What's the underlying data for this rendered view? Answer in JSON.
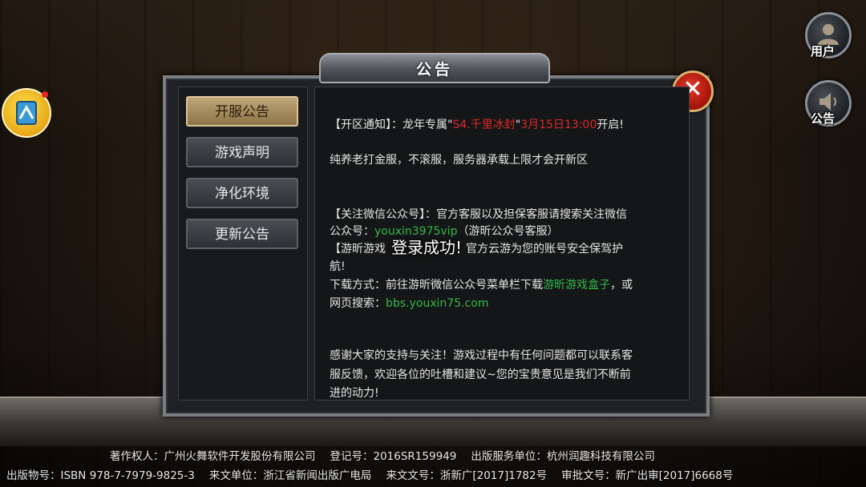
{
  "panel_title": "公告",
  "close_icon": "close-icon",
  "right_buttons": [
    {
      "label": "用户",
      "icon": "user-icon"
    },
    {
      "label": "公告",
      "icon": "speaker-icon"
    }
  ],
  "tabs": [
    {
      "label": "开服公告",
      "active": true
    },
    {
      "label": "游戏声明",
      "active": false
    },
    {
      "label": "净化环境",
      "active": false
    },
    {
      "label": "更新公告",
      "active": false
    }
  ],
  "notice": {
    "l1_prefix": "【开区通知】：龙年专属\"",
    "l1_server": "S4.千里冰封",
    "l1_mid": "\"",
    "l1_time": "3月15日13:00",
    "l1_suffix": "开启!",
    "l2": "纯养老打金服，不滚服，服务器承载上限才会开新区",
    "l3": "【关注微信公众号】：官方客服以及担保客服请搜索关注微信",
    "l4_prefix": "公众号：",
    "l4_account": "youxin3975vip",
    "l4_suffix": "（游昕公众号客服）",
    "l5_prefix": "【游昕游戏",
    "l5_suffix": "官方云游为您的账号安全保驾护",
    "l6": "航!",
    "l7_prefix": "下载方式：前往游昕微信公众号菜单栏下载",
    "l7_link": "游昕游戏盒子",
    "l7_suffix": "，或",
    "l8_prefix": "网页搜索：",
    "l8_link": "bbs.youxin75.com",
    "l9": "感谢大家的支持与关注！游戏过程中有任何问题都可以联系客",
    "l10": "服反馈，欢迎各位的吐槽和建议~您的宝贵意见是我们不断前",
    "l11": "进的动力!"
  },
  "toast": "登录成功!",
  "footer": {
    "copyright": "著作权人：广州火舞软件开发股份有限公司",
    "reg": "登记号：2016SR159949",
    "publisher": "出版服务单位：杭州润趣科技有限公司",
    "isbn": "出版物号：ISBN 978-7-7979-9825-3",
    "from_unit": "来文单位：浙江省新闻出版广电局",
    "doc_no": "来文文号：浙新广[2017]1782号",
    "approval": "审批文号：新广出审[2017]6668号"
  },
  "colors": {
    "highlight_red": "#e02828",
    "link_green": "#35b84a",
    "active_tab": "#bfa678"
  }
}
